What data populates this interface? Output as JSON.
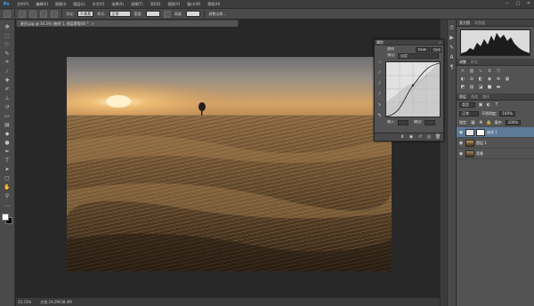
{
  "menubar": {
    "logo": "Ps",
    "items": [
      "文件(F)",
      "编辑(E)",
      "图像(I)",
      "图层(L)",
      "文字(Y)",
      "选择(S)",
      "滤镜(T)",
      "3D(D)",
      "视图(V)",
      "窗口(W)",
      "帮助(H)"
    ],
    "window_controls": [
      "—",
      "□",
      "✕"
    ]
  },
  "options": {
    "feather_label": "羽化:",
    "feather_value": "0 像素",
    "style_label": "样式:",
    "style_value": "正常",
    "width_label": "宽度:",
    "height_label": "高度:",
    "refine_label": "调整边缘..."
  },
  "document": {
    "tab_title": "麦田.jpg @ 33.3% (曲线 1, 图层蒙版/8) *",
    "close_glyph": "×"
  },
  "status": {
    "zoom": "33.33%",
    "doc_size": "文档:19.2M/38.4M"
  },
  "panels": {
    "histogram_tab": "直方图",
    "navigator_tab": "导航器",
    "adjustments_tab": "调整",
    "styles_tab": "样式",
    "layers_tab": "图层",
    "channels_tab": "通道",
    "paths_tab": "路径",
    "kind_label": "类型",
    "blend_mode": "正常",
    "opacity_label": "不透明度:",
    "opacity_value": "100%",
    "lock_label": "锁定:",
    "fill_label": "填充:",
    "fill_value": "100%",
    "layers": [
      {
        "name": "曲线 1",
        "selected": true
      },
      {
        "name": "图层 1",
        "selected": false
      },
      {
        "name": "背景",
        "selected": false
      }
    ]
  },
  "properties": {
    "tab_title": "属性",
    "sub_title": "曲线",
    "preset_label": "预设:",
    "preset_value": "自定",
    "channel_value": "RGB",
    "auto_label": "自动",
    "input_label": "输入:",
    "output_label": "输出:"
  },
  "colors": {
    "ps_blue": "#3fa0ff",
    "selected_layer": "#5d7a99",
    "foreground": "#ffffff",
    "background": "#000000"
  }
}
